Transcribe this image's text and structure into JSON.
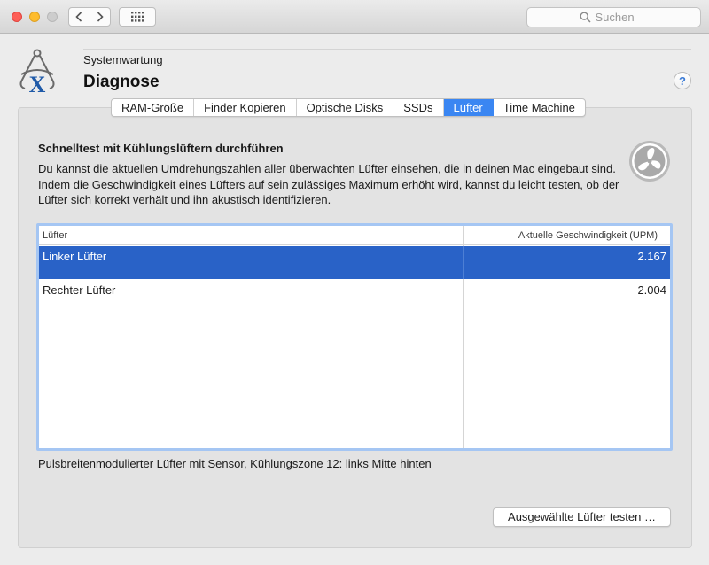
{
  "toolbar": {
    "search_placeholder": "Suchen"
  },
  "header": {
    "subtitle": "Systemwartung",
    "title": "Diagnose",
    "help_label": "?"
  },
  "tabs": [
    {
      "label": "RAM-Größe",
      "active": false
    },
    {
      "label": "Finder Kopieren",
      "active": false
    },
    {
      "label": "Optische Disks",
      "active": false
    },
    {
      "label": "SSDs",
      "active": false
    },
    {
      "label": "Lüfter",
      "active": true
    },
    {
      "label": "Time Machine",
      "active": false
    }
  ],
  "section": {
    "heading": "Schnelltest mit Kühlungslüftern durchführen",
    "description": "Du kannst die aktuellen Umdrehungszahlen aller überwachten Lüfter einsehen, die in deinen Mac eingebaut sind. Indem die Geschwindigkeit eines Lüfters auf sein zulässiges Maximum erhöht wird, kannst du leicht testen, ob der Lüfter sich korrekt verhält und ihn akustisch identifizieren."
  },
  "table": {
    "columns": [
      "Lüfter",
      "Aktuelle Geschwindigkeit (UPM)"
    ],
    "rows": [
      {
        "name": "Linker Lüfter",
        "speed": "2.167",
        "selected": true
      },
      {
        "name": "Rechter Lüfter",
        "speed": "2.004",
        "selected": false
      }
    ]
  },
  "footnote": "Pulsbreitenmodulierter Lüfter mit Sensor, Kühlungszone 12: links Mitte hinten",
  "actions": {
    "test_button": "Ausgewählte Lüfter testen …"
  },
  "colors": {
    "accent": "#3a86f2",
    "selection": "#2962c7",
    "focus_ring": "#a5c6f3"
  },
  "icons": {
    "app": "calipers-x-icon",
    "fan": "fan-icon",
    "search": "search-icon"
  }
}
